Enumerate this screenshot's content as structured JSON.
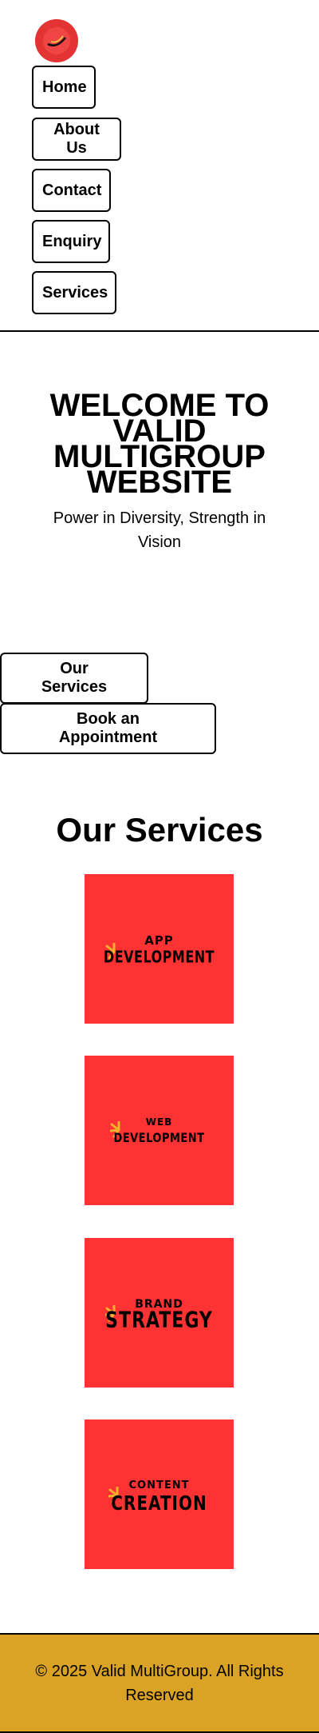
{
  "header": {
    "logo_icon": "brand-logo-icon",
    "logo_color": "#e33333",
    "nav": {
      "home": "Home",
      "about": "About Us",
      "contact": "Contact",
      "enquiry": "Enquiry",
      "services": "Services"
    }
  },
  "hero": {
    "title": "WELCOME TO VALID MULTIGROUP WEBSITE",
    "subtitle": "Power in Diversity, Strength in Vision",
    "cta_services": "Our Services",
    "cta_appointment": "Book an Appointment"
  },
  "services": {
    "heading": "Our Services",
    "card_color": "#fd3232",
    "cards": [
      {
        "line1": "APP",
        "line2": "DEVELOPMENT"
      },
      {
        "line1": "WEB",
        "line2": "DEVELOPMENT"
      },
      {
        "line1": "BRAND",
        "line2": "STRATEGY"
      },
      {
        "line1": "CONTENT",
        "line2": "CREATION"
      }
    ]
  },
  "footer": {
    "text": "© 2025 Valid MultiGroup. All Rights Reserved",
    "color": "#dba325"
  }
}
